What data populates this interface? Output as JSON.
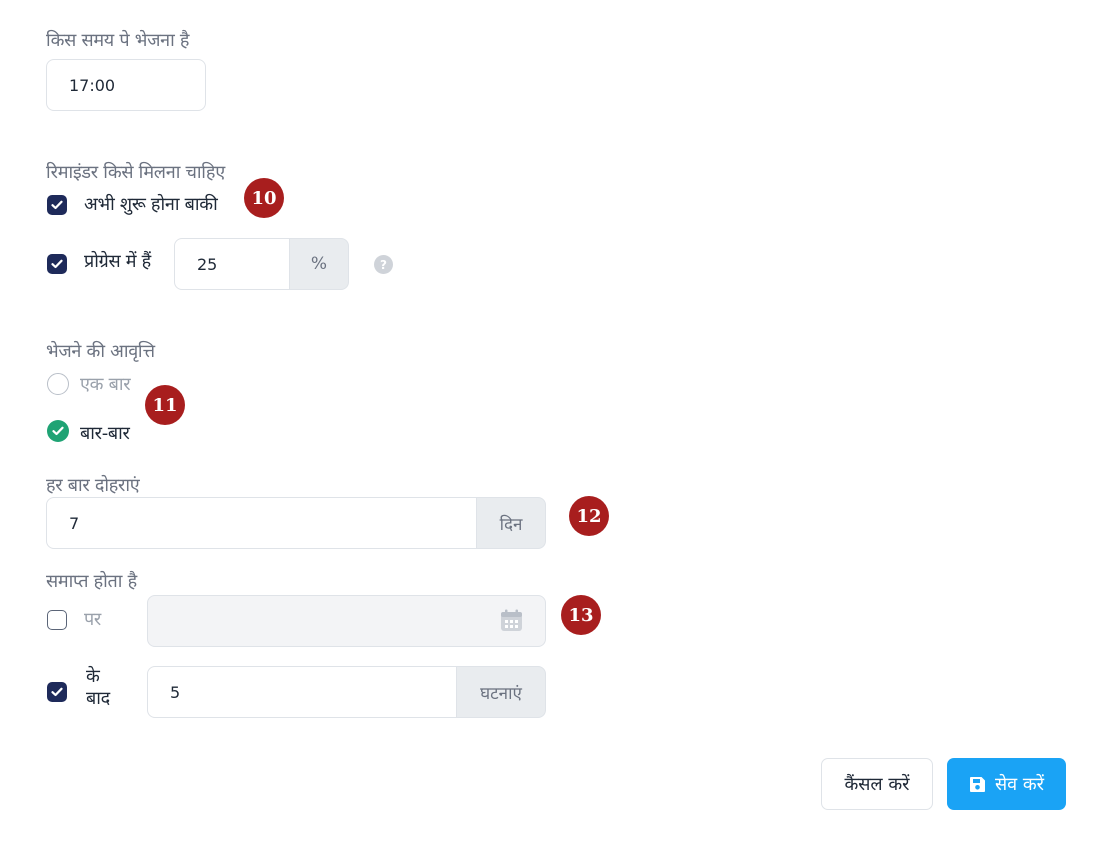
{
  "time_section": {
    "label": "किस समय पे भेजना है",
    "value": "17:00"
  },
  "reminder_section": {
    "label": "रिमाइंडर किसे मिलना चाहिए",
    "not_started": {
      "label": "अभी शुरू होना बाकी",
      "checked": true
    },
    "in_progress": {
      "label": "प्रोग्रेस में हैं",
      "checked": true,
      "value": "25",
      "unit": "%"
    }
  },
  "frequency_section": {
    "label": "भेजने की आवृत्ति",
    "options": [
      {
        "label": "एक बार",
        "selected": false
      },
      {
        "label": "बार-बार",
        "selected": true
      }
    ]
  },
  "repeat_section": {
    "label": "हर बार दोहराएं",
    "value": "7",
    "unit": "दिन"
  },
  "ends_section": {
    "label": "समाप्त होता है",
    "on": {
      "label": "पर",
      "checked": false,
      "date_value": ""
    },
    "after": {
      "label_line1": "के",
      "label_line2": "बाद",
      "checked": true,
      "value": "5",
      "unit": "घटनाएं"
    }
  },
  "buttons": {
    "cancel": "कैंसल करें",
    "save": "सेव करें"
  },
  "badges": [
    "10",
    "11",
    "12",
    "13"
  ],
  "colors": {
    "primary": "#1aa3f5",
    "checkbox": "#1e2a5a",
    "radio_selected": "#1fa374",
    "badge": "#a81e1e"
  }
}
